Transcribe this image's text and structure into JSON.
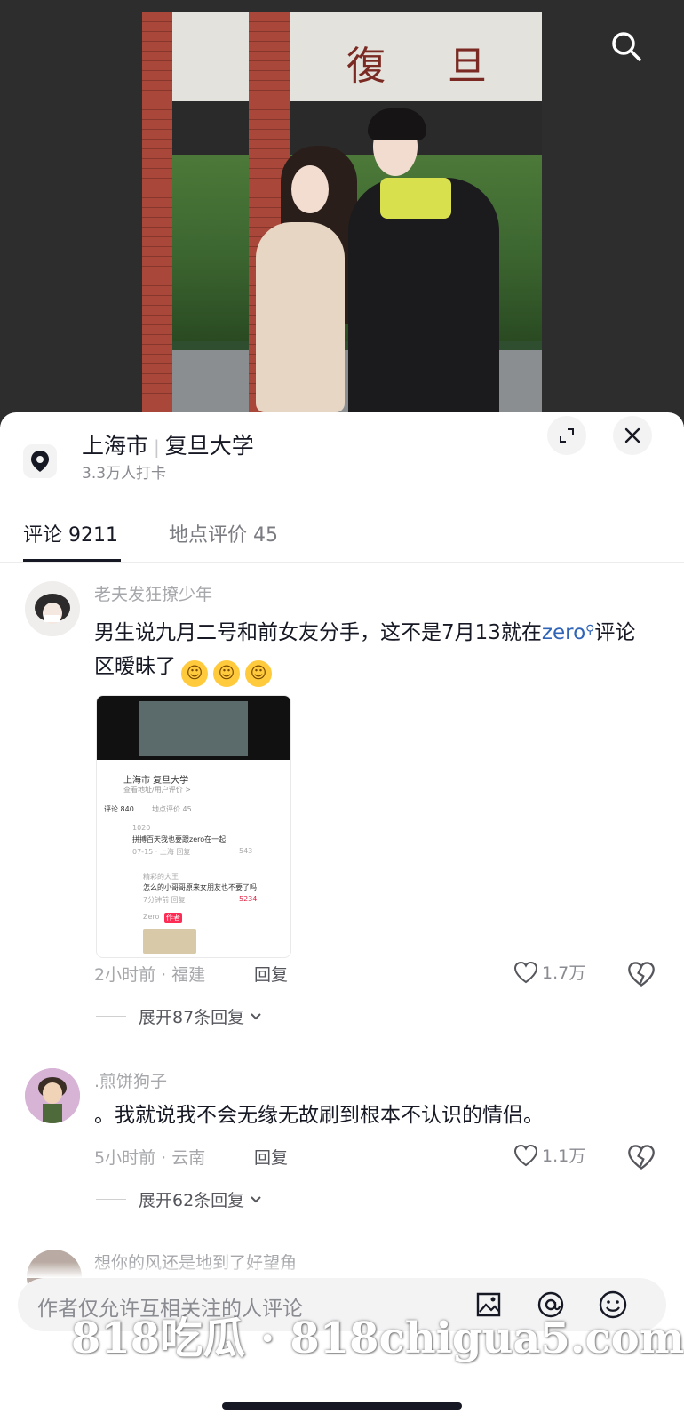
{
  "location": {
    "city": "上海市",
    "place": "复旦大学",
    "checkins": "3.3万人打卡"
  },
  "photo": {
    "gate_sign": "復 旦 大"
  },
  "tabs": [
    {
      "label": "评论 9211",
      "active": true
    },
    {
      "label": "地点评价 45",
      "active": false
    }
  ],
  "comments": [
    {
      "username": "老夫发狂撩少年",
      "text_before_mention": "男生说九月二号和前女友分手，这不是7月13就在",
      "mention": "zero",
      "text_after_mention": "评论区暧昧了",
      "meta": "2小时前 · 福建",
      "reply_label": "回复",
      "likes": "1.7万",
      "expand_label": "展开87条回复",
      "attachment": {
        "city": "上海市  复旦大学",
        "sub": "查看地址/用户评价 >",
        "tab1": "评论 840",
        "tab2": "地点评价 45",
        "c1_name": "1020",
        "c1_text": "拼搏百天我也要跟zero在一起",
        "c1_meta": "07-15 · 上海   回复",
        "c1_likes": "543",
        "c2_name": "精彩的大王",
        "c2_text": "怎么的小哥哥原来女朋友也不要了吗",
        "c2_meta": "7分钟前   回复",
        "c2_likes": "5234",
        "c3_name": "Zero",
        "c3_tag": "作者"
      }
    },
    {
      "username": ".煎饼狗子",
      "text": "。我就说我不会无缘无故刷到根本不认识的情侣。",
      "meta": "5小时前 · 云南",
      "reply_label": "回复",
      "likes": "1.1万",
      "expand_label": "展开62条回复"
    },
    {
      "username": "想你的风还是地到了好望角"
    }
  ],
  "input": {
    "placeholder": "作者仅允许互相关注的人评论"
  },
  "watermark": "818吃瓜 · 818chigua5.com",
  "colors": {
    "mention": "#2f64b7",
    "text_primary": "#161823",
    "text_secondary": "#a6a7ab",
    "sheet_bg": "#ffffff"
  },
  "icons": [
    "search-icon",
    "location-pin-icon",
    "expand-icon",
    "close-icon",
    "heart-icon",
    "broken-heart-icon",
    "chevron-down-icon",
    "image-icon",
    "at-icon",
    "emoji-icon"
  ]
}
